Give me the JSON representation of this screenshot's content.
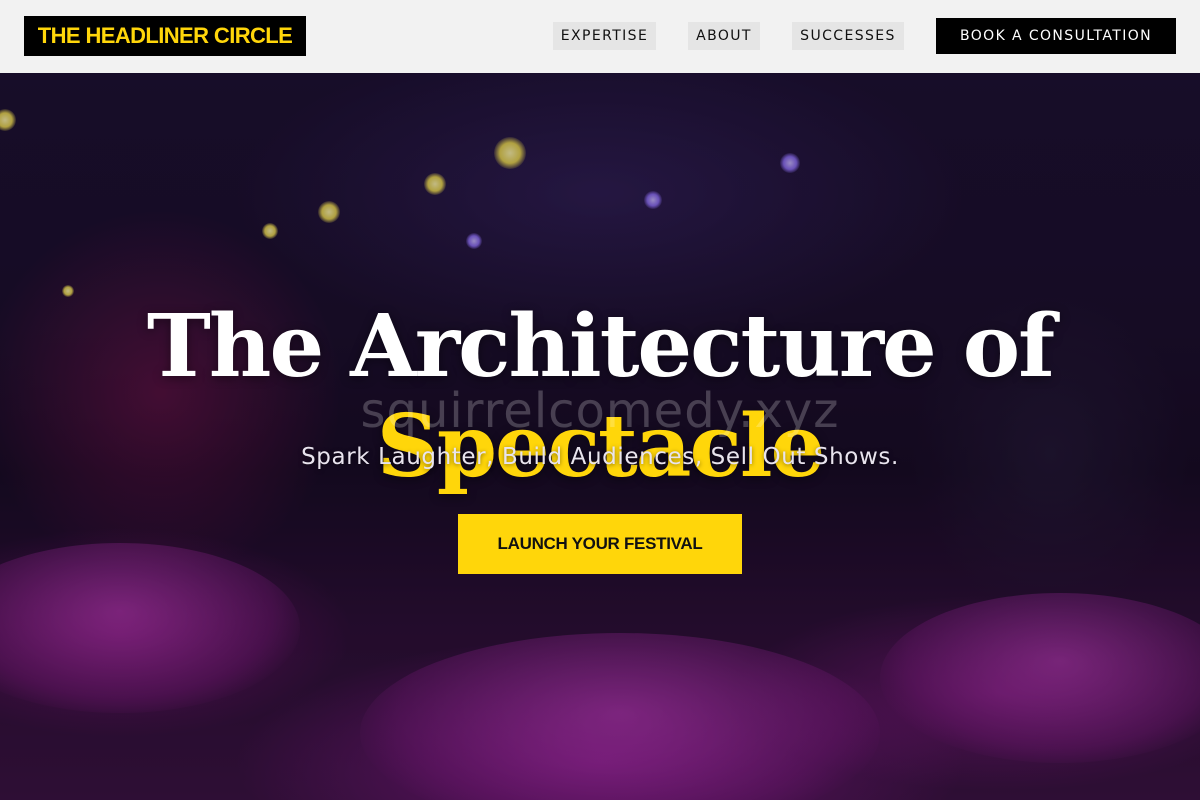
{
  "header": {
    "logo": "THE HEADLINER CIRCLE",
    "nav": [
      "EXPERTISE",
      "ABOUT",
      "SUCCESSES"
    ],
    "cta": "BOOK A CONSULTATION"
  },
  "hero": {
    "title_line1": "The Architecture of",
    "title_line2": "Spectacle",
    "watermark": "squirrelcomedy.xyz",
    "subtitle": "Spark Laughter, Build Audiences, Sell Out Shows.",
    "cta": "LAUNCH YOUR FESTIVAL",
    "background": "event-venue-photo"
  },
  "colors": {
    "accent": "#ffd60a",
    "header_bg": "#f2f2f2",
    "button_dark": "#000000"
  }
}
